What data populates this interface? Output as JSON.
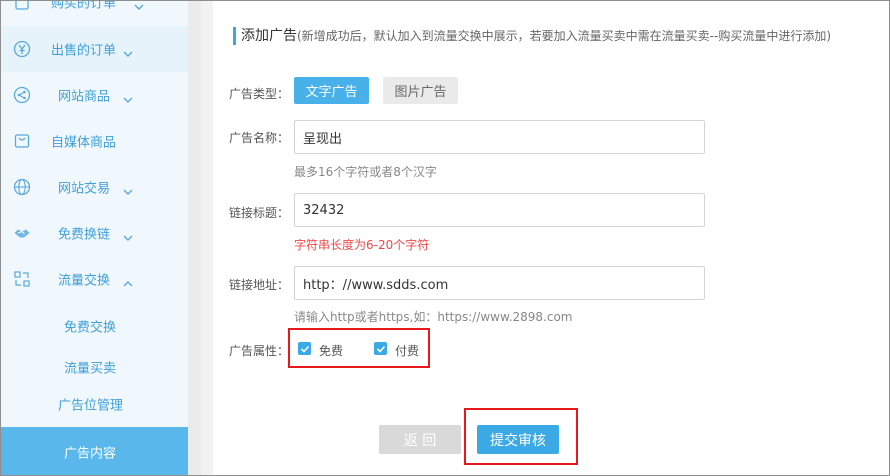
{
  "sidebar": {
    "items": [
      {
        "label": "购买的订单",
        "icon": "orders-icon"
      },
      {
        "label": "出售的订单",
        "icon": "yen-icon"
      },
      {
        "label": "网站商品",
        "icon": "share-icon"
      },
      {
        "label": "自媒体商品",
        "icon": "bag-icon"
      },
      {
        "label": "网站交易",
        "icon": "globe-icon"
      },
      {
        "label": "免费换链",
        "icon": "handshake-icon"
      },
      {
        "label": "流量交换",
        "icon": "exchange-icon"
      }
    ],
    "subitems": [
      {
        "label": "免费交换"
      },
      {
        "label": "流量买卖"
      },
      {
        "label": "广告位管理"
      },
      {
        "label": "广告内容"
      }
    ]
  },
  "main": {
    "title": "添加广告",
    "subtitle": "(新增成功后，默认加入到流量交换中展示，若要加入流量买卖中需在流量买卖--购买流量中进行添加)",
    "ad_type": {
      "label": "广告类型：",
      "options": [
        "文字广告",
        "图片广告"
      ],
      "selected": "文字广告"
    },
    "ad_name": {
      "label": "广告名称：",
      "value": "呈现出",
      "hint": "最多16个字符或者8个汉字"
    },
    "link_title": {
      "label": "链接标题：",
      "value": "32432",
      "error": "字符串长度为6-20个字符"
    },
    "link_url": {
      "label": "链接地址：",
      "value": "http：//www.sdds.com",
      "hint": "请输入http或者https,如：https://www.2898.com"
    },
    "ad_attr": {
      "label": "广告属性：",
      "options": [
        {
          "label": "免费",
          "checked": true
        },
        {
          "label": "付费",
          "checked": true
        }
      ]
    },
    "back_label": "返 回",
    "submit_label": "提交审核"
  },
  "colors": {
    "accent": "#3aa9e6",
    "sidebar_text": "#3f9fd8",
    "error": "#f04848",
    "highlight_box": "#e8191c"
  }
}
